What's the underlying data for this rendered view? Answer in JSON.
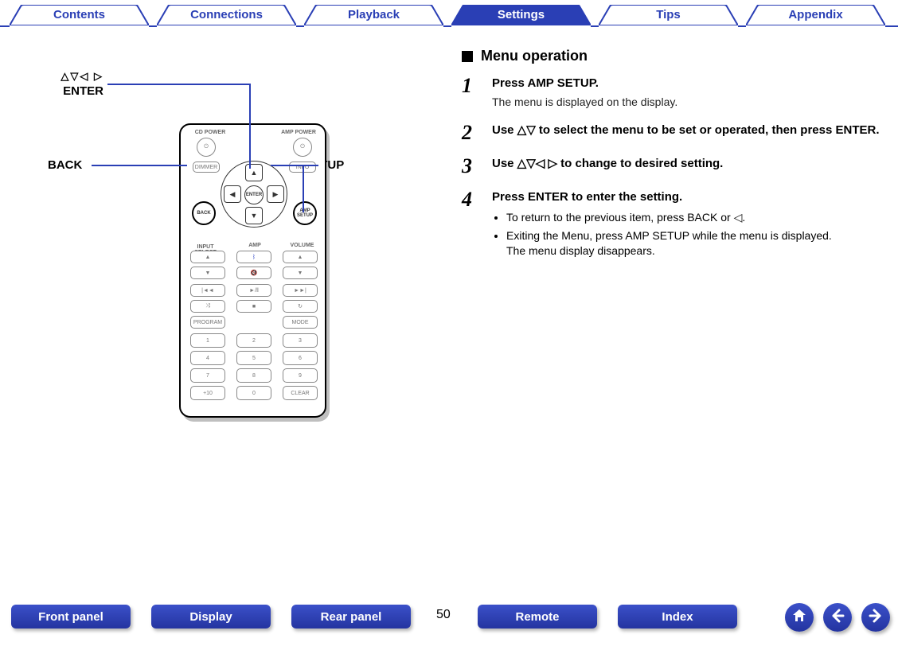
{
  "colors": {
    "brand": "#2a3fb5"
  },
  "top_tabs": {
    "items": [
      "Contents",
      "Connections",
      "Playback",
      "Settings",
      "Tips",
      "Appendix"
    ],
    "active_index": 3
  },
  "callouts": {
    "enter_arrows": "△▽◁ ▷",
    "enter": "ENTER",
    "back": "BACK",
    "amp_setup": "AMP SETUP"
  },
  "remote": {
    "top_labels": {
      "cd_power": "CD POWER",
      "amp_power": "AMP POWER"
    },
    "side_left": "BACK",
    "side_right": "AMP SETUP",
    "dimmer": "DIMMER",
    "info": "INFO",
    "center": "ENTER",
    "rows": {
      "input_select": "INPUT SELECT",
      "amp": "AMP",
      "volume": "VOLUME",
      "program": "PROGRAM",
      "mode": "MODE",
      "clear": "CLEAR",
      "plus10": "+10"
    },
    "keypad": [
      "1",
      "2",
      "3",
      "4",
      "5",
      "6",
      "7",
      "8",
      "9",
      "0"
    ]
  },
  "section_title": "Menu operation",
  "steps": [
    {
      "num": "1",
      "bold": "Press AMP SETUP.",
      "sub": "The menu is displayed on the display."
    },
    {
      "num": "2",
      "bold": "Use △▽ to select the menu to be set or operated, then press ENTER."
    },
    {
      "num": "3",
      "bold": "Use △▽◁ ▷ to change to desired setting."
    },
    {
      "num": "4",
      "bold": "Press ENTER to enter the setting.",
      "bullets": [
        "To return to the previous item, press BACK or ◁.",
        "Exiting the Menu, press AMP SETUP while the menu is displayed.\nThe menu display disappears."
      ]
    }
  ],
  "bottom": {
    "buttons": [
      "Front panel",
      "Display",
      "Rear panel",
      "Remote",
      "Index"
    ],
    "page": "50"
  }
}
